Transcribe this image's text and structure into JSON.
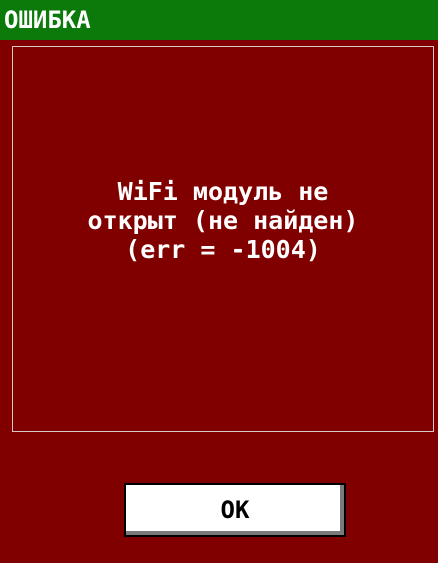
{
  "dialog": {
    "title": "ОШИБКА",
    "message": "WiFi модуль не\nоткрыт (не найден)\n(err = -1004)",
    "ok_label": "OK"
  },
  "colors": {
    "title_bar": "#0b7a0b",
    "body": "#800000",
    "text": "#ffffff",
    "button_bg": "#ffffff"
  }
}
